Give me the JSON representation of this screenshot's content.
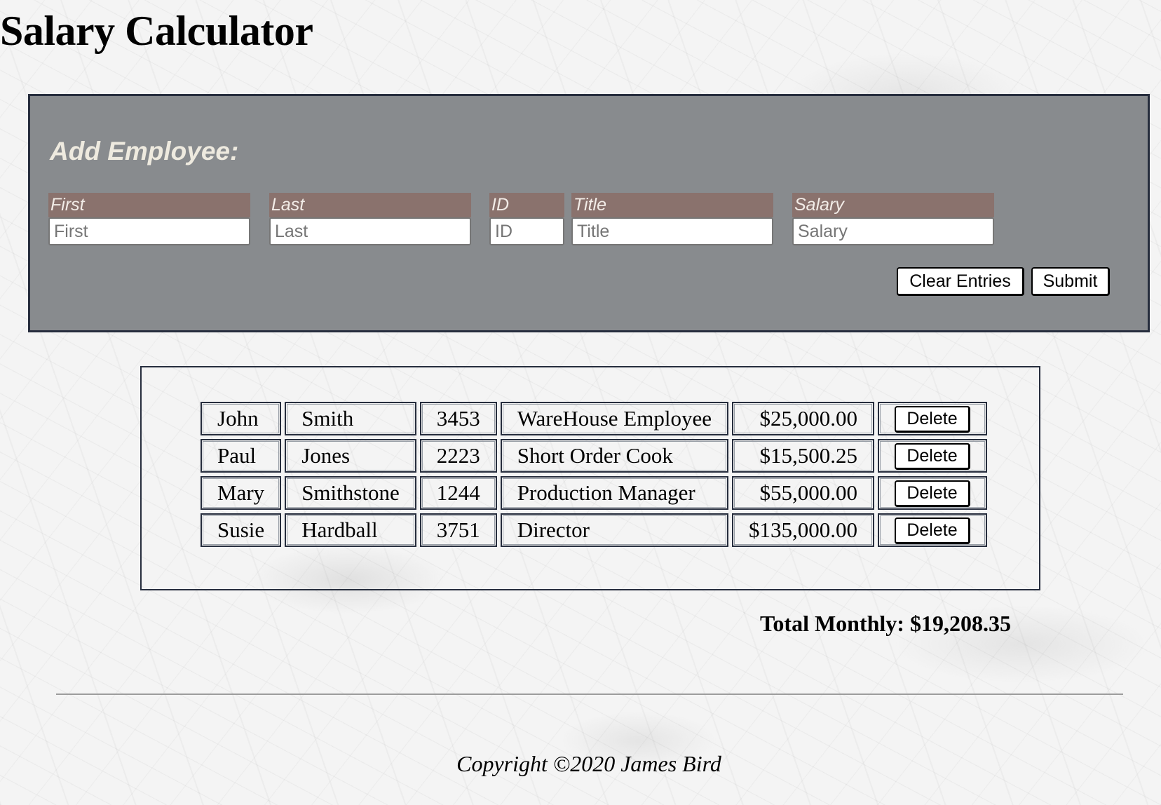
{
  "page": {
    "title": "Salary Calculator"
  },
  "form": {
    "heading": "Add Employee:",
    "fields": [
      {
        "label": "First",
        "placeholder": "First",
        "value": ""
      },
      {
        "label": "Last",
        "placeholder": "Last",
        "value": ""
      },
      {
        "label": "ID",
        "placeholder": "ID",
        "value": ""
      },
      {
        "label": "Title",
        "placeholder": "Title",
        "value": ""
      },
      {
        "label": "Salary",
        "placeholder": "Salary",
        "value": ""
      }
    ],
    "clear_label": "Clear Entries",
    "submit_label": "Submit"
  },
  "employees": {
    "delete_label": "Delete",
    "rows": [
      {
        "first": "John",
        "last": "Smith",
        "id": "3453",
        "title": "WareHouse Employee",
        "salary": "$25,000.00"
      },
      {
        "first": "Paul",
        "last": "Jones",
        "id": "2223",
        "title": "Short Order Cook",
        "salary": "$15,500.25"
      },
      {
        "first": "Mary",
        "last": "Smithstone",
        "id": "1244",
        "title": "Production Manager",
        "salary": "$55,000.00"
      },
      {
        "first": "Susie",
        "last": "Hardball",
        "id": "3751",
        "title": "Director",
        "salary": "$135,000.00"
      }
    ]
  },
  "total": {
    "label": "Total Monthly:",
    "value": "$19,208.35"
  },
  "footer": {
    "copyright": "Copyright ©2020 James Bird"
  },
  "colors": {
    "panel_background": "#888b8e",
    "panel_border": "#262d3d",
    "field_label_background": "#8a726d",
    "heading_text": "#eeeadf"
  }
}
